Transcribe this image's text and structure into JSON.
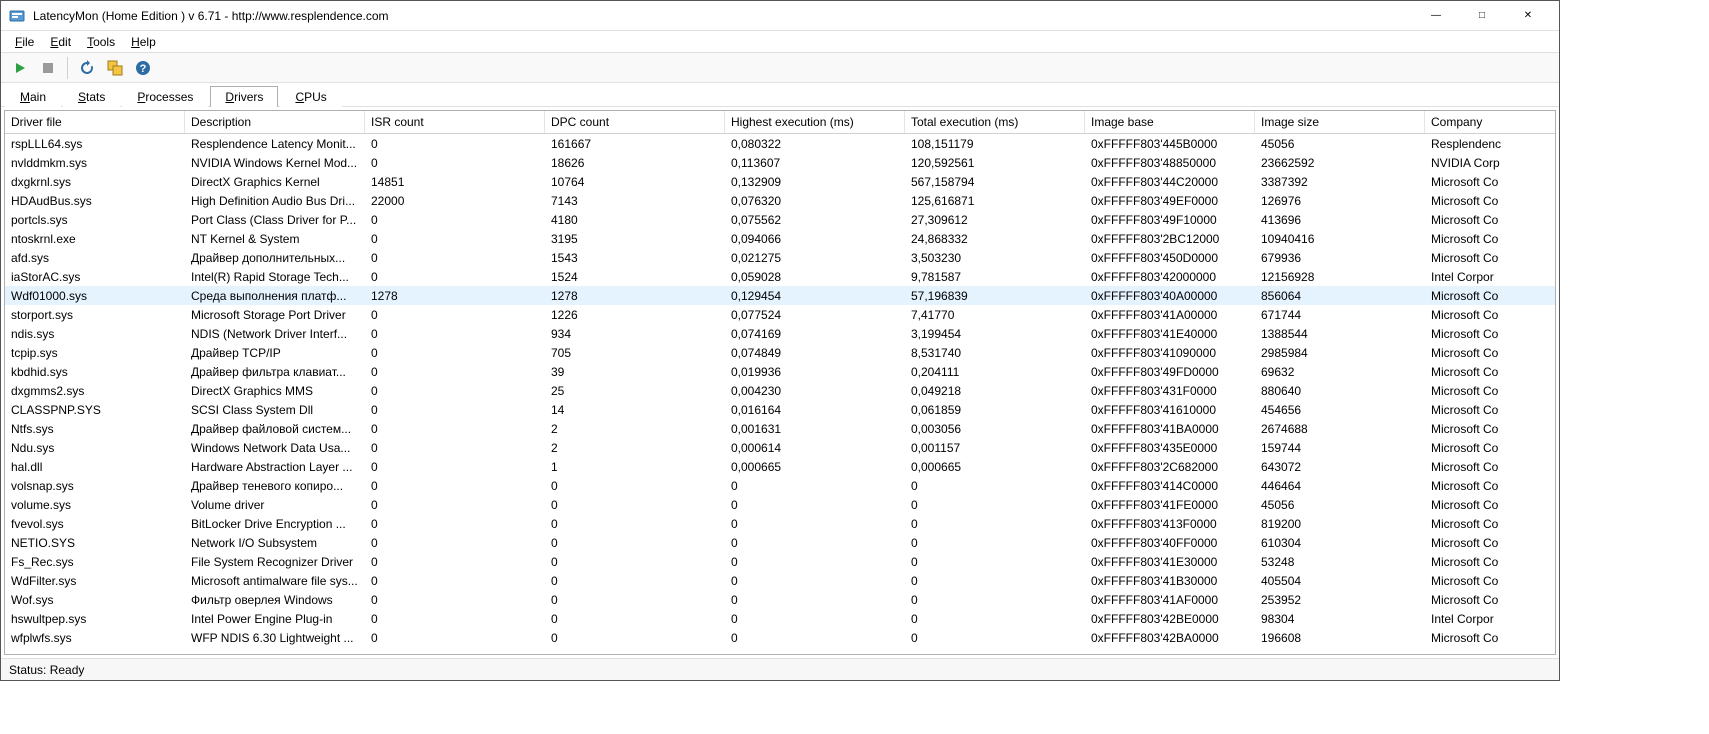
{
  "window": {
    "title": "LatencyMon  (Home Edition )  v 6.71 - http://www.resplendence.com"
  },
  "menubar": {
    "file": "File",
    "edit": "Edit",
    "tools": "Tools",
    "help": "Help"
  },
  "tabs": {
    "main": "Main",
    "stats": "Stats",
    "processes": "Processes",
    "drivers": "Drivers",
    "cpus": "CPUs",
    "active": "drivers"
  },
  "status": {
    "text": "Status: Ready"
  },
  "columns": [
    "Driver file",
    "Description",
    "ISR count",
    "DPC count",
    "Highest execution (ms)",
    "Total execution (ms)",
    "Image base",
    "Image size",
    "Company"
  ],
  "selected_index": 8,
  "rows": [
    {
      "file": "rspLLL64.sys",
      "desc": "Resplendence Latency Monit...",
      "isr": "0",
      "dpc": "161667",
      "hi": "0,080322",
      "tot": "108,151179",
      "base": "0xFFFFF803'445B0000",
      "size": "45056",
      "company": "Resplendenc"
    },
    {
      "file": "nvlddmkm.sys",
      "desc": "NVIDIA Windows Kernel Mod...",
      "isr": "0",
      "dpc": "18626",
      "hi": "0,113607",
      "tot": "120,592561",
      "base": "0xFFFFF803'48850000",
      "size": "23662592",
      "company": "NVIDIA Corp"
    },
    {
      "file": "dxgkrnl.sys",
      "desc": "DirectX Graphics Kernel",
      "isr": "14851",
      "dpc": "10764",
      "hi": "0,132909",
      "tot": "567,158794",
      "base": "0xFFFFF803'44C20000",
      "size": "3387392",
      "company": "Microsoft Co"
    },
    {
      "file": "HDAudBus.sys",
      "desc": "High Definition Audio Bus Dri...",
      "isr": "22000",
      "dpc": "7143",
      "hi": "0,076320",
      "tot": "125,616871",
      "base": "0xFFFFF803'49EF0000",
      "size": "126976",
      "company": "Microsoft Co"
    },
    {
      "file": "portcls.sys",
      "desc": "Port Class (Class Driver for P...",
      "isr": "0",
      "dpc": "4180",
      "hi": "0,075562",
      "tot": "27,309612",
      "base": "0xFFFFF803'49F10000",
      "size": "413696",
      "company": "Microsoft Co"
    },
    {
      "file": "ntoskrnl.exe",
      "desc": "NT Kernel & System",
      "isr": "0",
      "dpc": "3195",
      "hi": "0,094066",
      "tot": "24,868332",
      "base": "0xFFFFF803'2BC12000",
      "size": "10940416",
      "company": "Microsoft Co"
    },
    {
      "file": "afd.sys",
      "desc": "Драйвер дополнительных...",
      "isr": "0",
      "dpc": "1543",
      "hi": "0,021275",
      "tot": "3,503230",
      "base": "0xFFFFF803'450D0000",
      "size": "679936",
      "company": "Microsoft Co"
    },
    {
      "file": "iaStorAC.sys",
      "desc": "Intel(R) Rapid Storage Tech...",
      "isr": "0",
      "dpc": "1524",
      "hi": "0,059028",
      "tot": "9,781587",
      "base": "0xFFFFF803'42000000",
      "size": "12156928",
      "company": "Intel Corpor"
    },
    {
      "file": "Wdf01000.sys",
      "desc": "Среда выполнения платф...",
      "isr": "1278",
      "dpc": "1278",
      "hi": "0,129454",
      "tot": "57,196839",
      "base": "0xFFFFF803'40A00000",
      "size": "856064",
      "company": "Microsoft Co"
    },
    {
      "file": "storport.sys",
      "desc": "Microsoft Storage Port Driver",
      "isr": "0",
      "dpc": "1226",
      "hi": "0,077524",
      "tot": "7,41770",
      "base": "0xFFFFF803'41A00000",
      "size": "671744",
      "company": "Microsoft Co"
    },
    {
      "file": "ndis.sys",
      "desc": "NDIS (Network Driver Interf...",
      "isr": "0",
      "dpc": "934",
      "hi": "0,074169",
      "tot": "3,199454",
      "base": "0xFFFFF803'41E40000",
      "size": "1388544",
      "company": "Microsoft Co"
    },
    {
      "file": "tcpip.sys",
      "desc": "Драйвер TCP/IP",
      "isr": "0",
      "dpc": "705",
      "hi": "0,074849",
      "tot": "8,531740",
      "base": "0xFFFFF803'41090000",
      "size": "2985984",
      "company": "Microsoft Co"
    },
    {
      "file": "kbdhid.sys",
      "desc": "Драйвер фильтра клавиат...",
      "isr": "0",
      "dpc": "39",
      "hi": "0,019936",
      "tot": "0,204111",
      "base": "0xFFFFF803'49FD0000",
      "size": "69632",
      "company": "Microsoft Co"
    },
    {
      "file": "dxgmms2.sys",
      "desc": "DirectX Graphics MMS",
      "isr": "0",
      "dpc": "25",
      "hi": "0,004230",
      "tot": "0,049218",
      "base": "0xFFFFF803'431F0000",
      "size": "880640",
      "company": "Microsoft Co"
    },
    {
      "file": "CLASSPNP.SYS",
      "desc": "SCSI Class System Dll",
      "isr": "0",
      "dpc": "14",
      "hi": "0,016164",
      "tot": "0,061859",
      "base": "0xFFFFF803'41610000",
      "size": "454656",
      "company": "Microsoft Co"
    },
    {
      "file": "Ntfs.sys",
      "desc": "Драйвер файловой систем...",
      "isr": "0",
      "dpc": "2",
      "hi": "0,001631",
      "tot": "0,003056",
      "base": "0xFFFFF803'41BA0000",
      "size": "2674688",
      "company": "Microsoft Co"
    },
    {
      "file": "Ndu.sys",
      "desc": "Windows Network Data Usa...",
      "isr": "0",
      "dpc": "2",
      "hi": "0,000614",
      "tot": "0,001157",
      "base": "0xFFFFF803'435E0000",
      "size": "159744",
      "company": "Microsoft Co"
    },
    {
      "file": "hal.dll",
      "desc": "Hardware Abstraction Layer ...",
      "isr": "0",
      "dpc": "1",
      "hi": "0,000665",
      "tot": "0,000665",
      "base": "0xFFFFF803'2C682000",
      "size": "643072",
      "company": "Microsoft Co"
    },
    {
      "file": "volsnap.sys",
      "desc": "Драйвер теневого копиро...",
      "isr": "0",
      "dpc": "0",
      "hi": "0",
      "tot": "0",
      "base": "0xFFFFF803'414C0000",
      "size": "446464",
      "company": "Microsoft Co"
    },
    {
      "file": "volume.sys",
      "desc": "Volume driver",
      "isr": "0",
      "dpc": "0",
      "hi": "0",
      "tot": "0",
      "base": "0xFFFFF803'41FE0000",
      "size": "45056",
      "company": "Microsoft Co"
    },
    {
      "file": "fvevol.sys",
      "desc": "BitLocker Drive Encryption ...",
      "isr": "0",
      "dpc": "0",
      "hi": "0",
      "tot": "0",
      "base": "0xFFFFF803'413F0000",
      "size": "819200",
      "company": "Microsoft Co"
    },
    {
      "file": "NETIO.SYS",
      "desc": "Network I/O Subsystem",
      "isr": "0",
      "dpc": "0",
      "hi": "0",
      "tot": "0",
      "base": "0xFFFFF803'40FF0000",
      "size": "610304",
      "company": "Microsoft Co"
    },
    {
      "file": "Fs_Rec.sys",
      "desc": "File System Recognizer Driver",
      "isr": "0",
      "dpc": "0",
      "hi": "0",
      "tot": "0",
      "base": "0xFFFFF803'41E30000",
      "size": "53248",
      "company": "Microsoft Co"
    },
    {
      "file": "WdFilter.sys",
      "desc": "Microsoft antimalware file sys...",
      "isr": "0",
      "dpc": "0",
      "hi": "0",
      "tot": "0",
      "base": "0xFFFFF803'41B30000",
      "size": "405504",
      "company": "Microsoft Co"
    },
    {
      "file": "Wof.sys",
      "desc": "Фильтр оверлея Windows",
      "isr": "0",
      "dpc": "0",
      "hi": "0",
      "tot": "0",
      "base": "0xFFFFF803'41AF0000",
      "size": "253952",
      "company": "Microsoft Co"
    },
    {
      "file": "hswultpep.sys",
      "desc": "Intel Power Engine Plug-in",
      "isr": "0",
      "dpc": "0",
      "hi": "0",
      "tot": "0",
      "base": "0xFFFFF803'42BE0000",
      "size": "98304",
      "company": "Intel Corpor"
    },
    {
      "file": "wfplwfs.sys",
      "desc": "WFP NDIS 6.30 Lightweight ...",
      "isr": "0",
      "dpc": "0",
      "hi": "0",
      "tot": "0",
      "base": "0xFFFFF803'42BA0000",
      "size": "196608",
      "company": "Microsoft Co"
    }
  ]
}
